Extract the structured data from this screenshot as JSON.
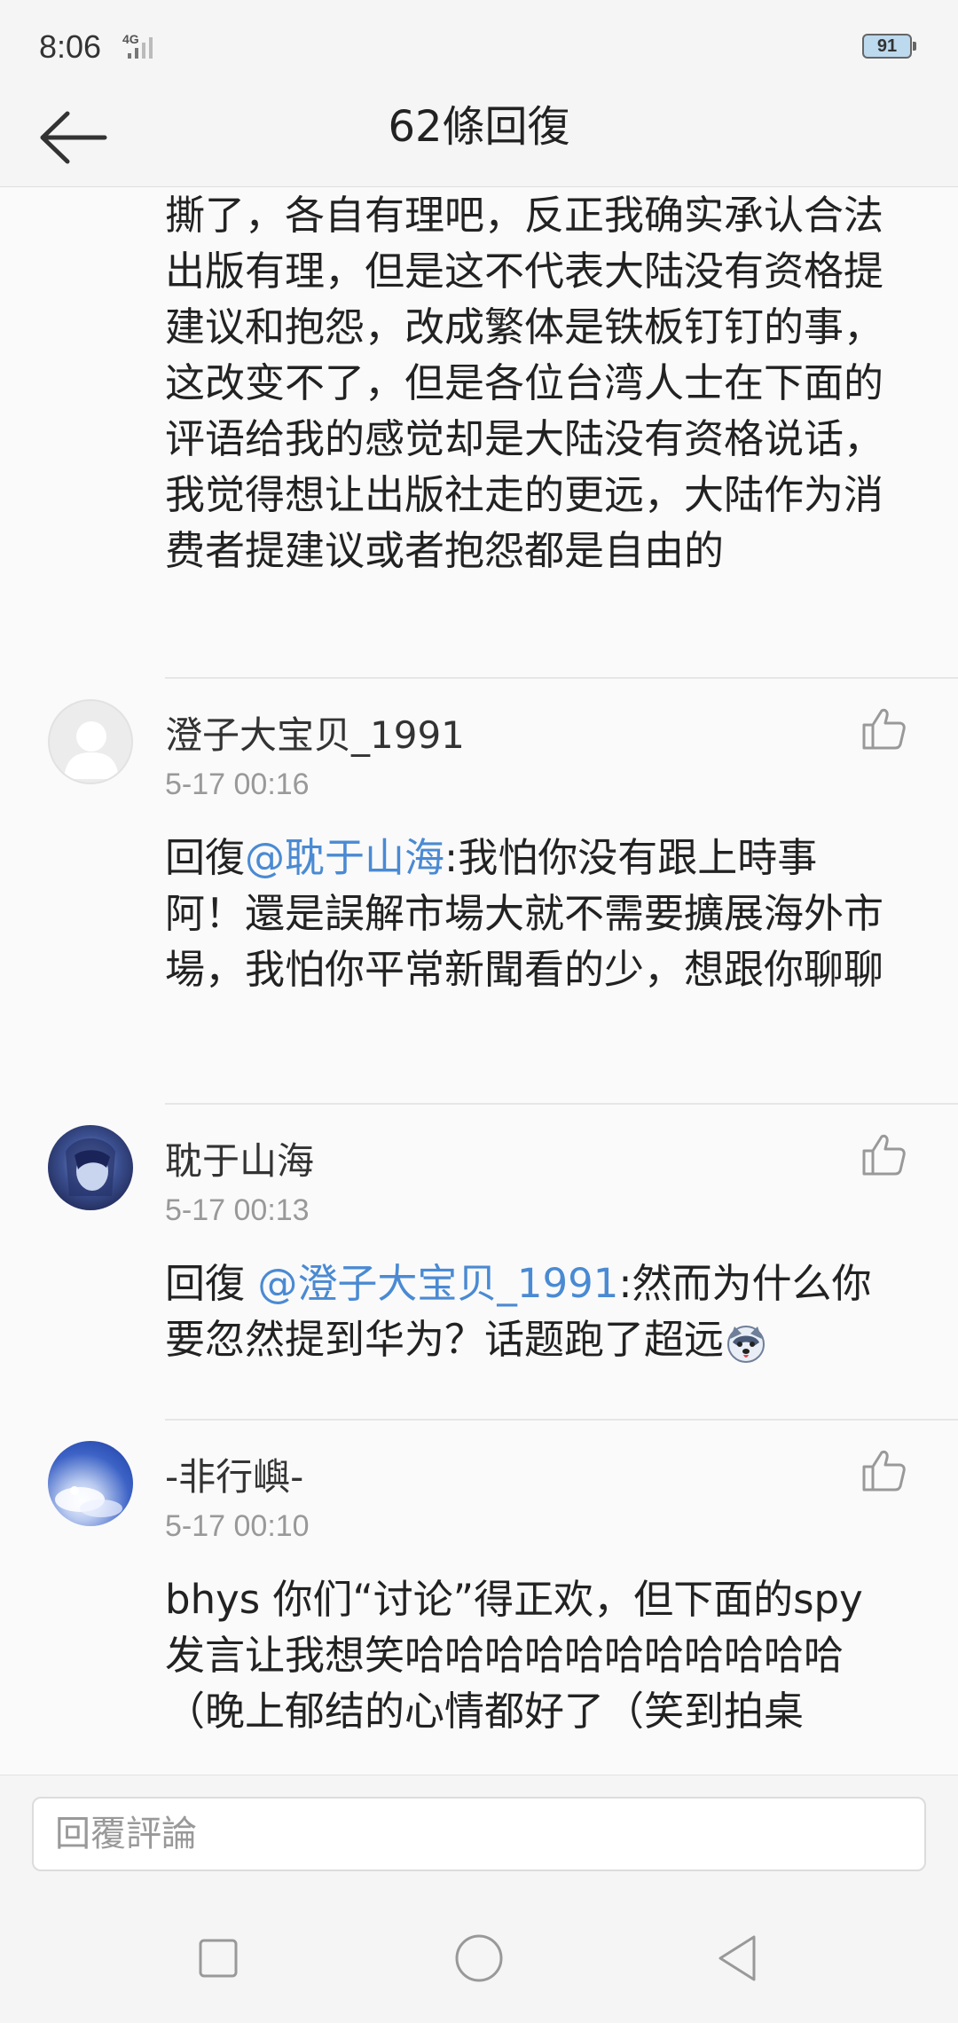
{
  "status_bar": {
    "time": "8:06",
    "network": "4G",
    "battery": "91"
  },
  "header": {
    "title": "62條回復"
  },
  "comments": [
    {
      "text": "撕了，各自有理吧，反正我确实承认合法出版有理，但是这不代表大陆没有资格提建议和抱怨，改成繁体是铁板钉钉的事，这改变不了，但是各位台湾人士在下面的评语给我的感觉却是大陆没有资格说话，我觉得想让出版社走的更远，大陆作为消费者提建议或者抱怨都是自由的"
    },
    {
      "username": "澄子大宝贝_1991",
      "time": "5-17 00:16",
      "reply_prefix": "回復",
      "mention": "@耽于山海",
      "text": ":我怕你没有跟上時事阿！還是誤解市場大就不需要擴展海外市場，我怕你平常新聞看的少，想跟你聊聊"
    },
    {
      "username": "耽于山海",
      "time": "5-17 00:13",
      "reply_prefix": "回復 ",
      "mention": "@澄子大宝贝_1991",
      "text": ":然而为什么你要忽然提到华为？话题跑了超远",
      "emoji": "husky-face-emoji"
    },
    {
      "username": "-非行嶼-",
      "time": "5-17 00:10",
      "text": "bhys 你们“讨论”得正欢，但下面的spy发言让我想笑哈哈哈哈哈哈哈哈哈哈哈（晚上郁结的心情都好了（笑到拍桌"
    }
  ],
  "reply_bar": {
    "placeholder": "回覆評論"
  },
  "colors": {
    "mention": "#4a8ad3",
    "timestamp": "#999999",
    "background": "#fafafa"
  },
  "icons": [
    "back-arrow-icon",
    "thumbs-up-icon",
    "square-icon",
    "circle-icon",
    "triangle-back-icon"
  ]
}
